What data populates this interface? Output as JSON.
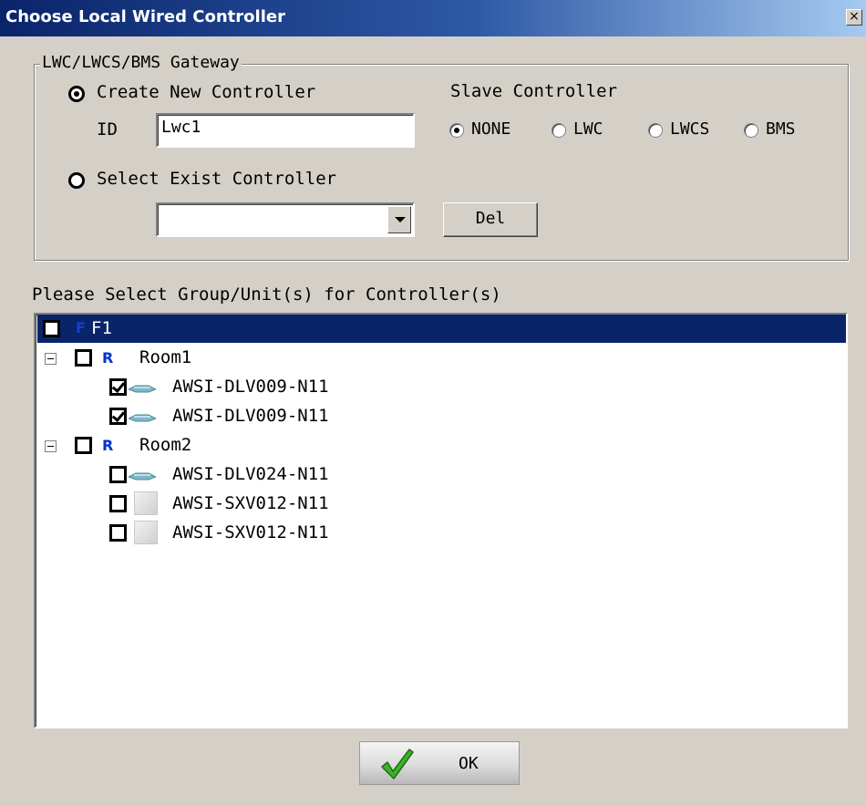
{
  "window": {
    "title": "Choose Local Wired Controller",
    "close_glyph": "×"
  },
  "gateway": {
    "group_title": "LWC/LWCS/BMS Gateway",
    "create_new_label": "Create New Controller",
    "id_label": "ID",
    "id_value": "Lwc1",
    "select_exist_label": "Select Exist Controller",
    "select_value": "",
    "del_label": "Del",
    "slave_title": "Slave Controller",
    "slave_options": [
      "NONE",
      "LWC",
      "LWCS",
      "BMS"
    ],
    "slave_selected": "NONE"
  },
  "tree": {
    "prompt": "Please Select Group/Unit(s) for Controller(s)",
    "floor": {
      "badge": "F",
      "label": "F1"
    },
    "rooms": [
      {
        "badge": "R",
        "label": "Room1",
        "units": [
          {
            "label": "AWSI-DLV009-N11",
            "checked": true,
            "icon": "indoor-unit-icon"
          },
          {
            "label": "AWSI-DLV009-N11",
            "checked": true,
            "icon": "indoor-unit-icon"
          }
        ]
      },
      {
        "badge": "R",
        "label": "Room2",
        "units": [
          {
            "label": "AWSI-DLV024-N11",
            "checked": false,
            "icon": "indoor-unit-icon"
          },
          {
            "label": "AWSI-SXV012-N11",
            "checked": false,
            "icon": "wall-unit-icon"
          },
          {
            "label": "AWSI-SXV012-N11",
            "checked": false,
            "icon": "wall-unit-icon"
          }
        ]
      }
    ]
  },
  "footer": {
    "ok_label": "OK"
  },
  "colors": {
    "selection": "#0a246a",
    "badge": "#0033cc",
    "check_green": "#2e9e1e"
  }
}
